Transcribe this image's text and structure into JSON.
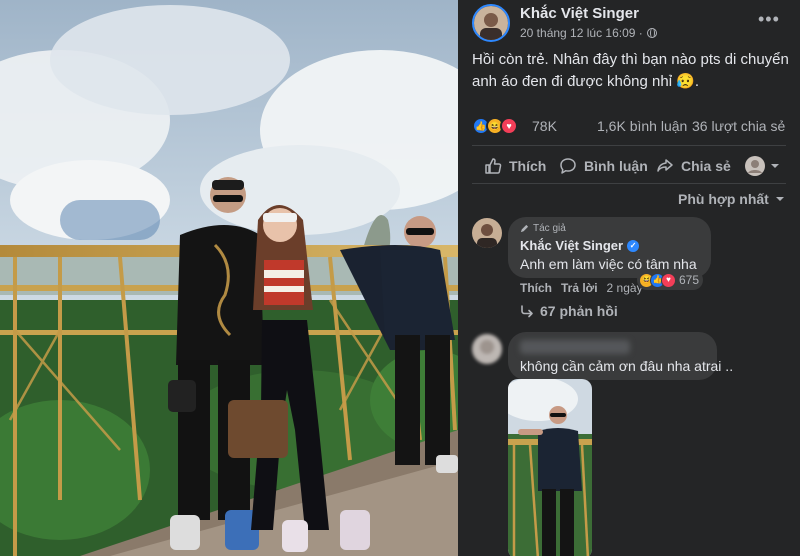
{
  "post": {
    "author": "Khắc Việt Singer",
    "timestamp": "20 tháng 12 lúc 16:09 ·",
    "more_icon": "more-icon",
    "text": "Hồi còn trẻ. Nhân đây thì bạn nào pts di chuyển anh áo đen đi được không nhỉ 😥."
  },
  "stats": {
    "reaction_count": "78K",
    "comments": "1,6K bình luận",
    "shares": "36 lượt chia sẻ"
  },
  "actions": {
    "like": "Thích",
    "comment": "Bình luận",
    "share": "Chia sẻ"
  },
  "sort": {
    "label": "Phù hợp nhất"
  },
  "comments": [
    {
      "author_tag": "Tác giả",
      "author": "Khắc Việt Singer",
      "text": "Anh em làm việc có tâm nha",
      "like_label": "Thích",
      "reply_label": "Trả lời",
      "time": "2 ngày",
      "reaction_count": "675",
      "replies_label": "67 phản hồi"
    },
    {
      "text": "không cần cảm ơn đâu nha atrai .."
    }
  ],
  "colors": {
    "panel_bg": "#242526",
    "bubble_bg": "#3a3b3c",
    "accent": "#2d88ff",
    "like_blue": "#2078f4",
    "love_red": "#f33e58",
    "haha_yellow": "#f7b125"
  }
}
